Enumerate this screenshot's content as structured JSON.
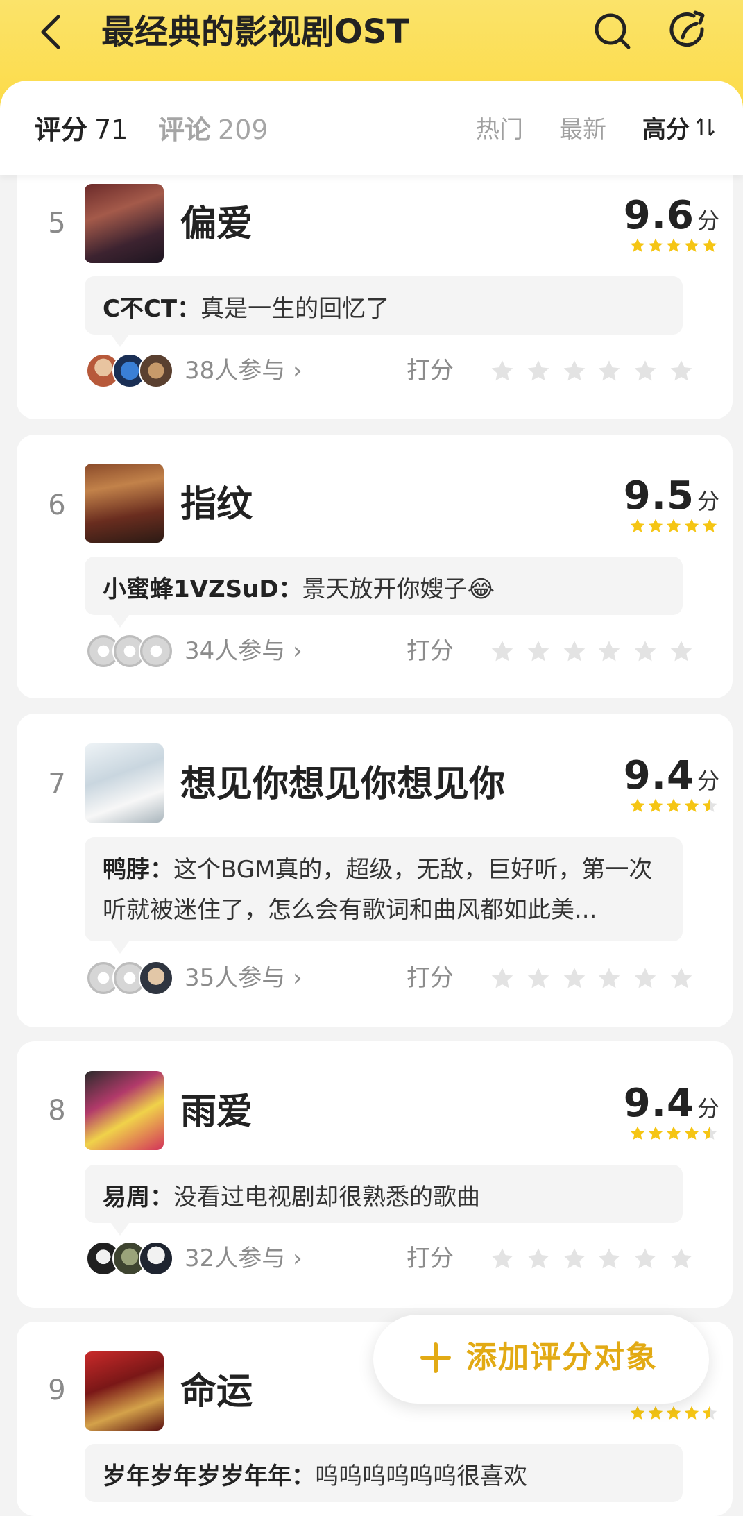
{
  "header": {
    "title": "最经典的影视剧OST",
    "back_icon": "chevron-left-icon",
    "search_icon": "search-icon",
    "share_icon": "share-icon",
    "bg_color": "#fcd93f"
  },
  "tabs": {
    "score_label": "评分",
    "score_count": "71",
    "comment_label": "评论",
    "comment_count": "209",
    "sort_hot": "热门",
    "sort_new": "最新",
    "sort_high": "高分",
    "sort_icon": "sort-toggle-icon"
  },
  "items": [
    {
      "rank": "5",
      "title": "偏爱",
      "score": "9.6",
      "score_unit": "分",
      "stars": 5,
      "comment_user": "C不CT：",
      "comment_text": "真是一生的回忆了",
      "participants": "38人参与",
      "rate_label": "打分"
    },
    {
      "rank": "6",
      "title": "指纹",
      "score": "9.5",
      "score_unit": "分",
      "stars": 5,
      "comment_user": "小蜜蜂1VZSuD：",
      "comment_text": "景天放开你嫂子😂",
      "participants": "34人参与",
      "rate_label": "打分"
    },
    {
      "rank": "7",
      "title": "想见你想见你想见你",
      "score": "9.4",
      "score_unit": "分",
      "stars": 4.5,
      "comment_user": "鸭脖：",
      "comment_text": "这个BGM真的，超级，无敌，巨好听，第一次听就被迷住了，怎么会有歌词和曲风都如此美...",
      "participants": "35人参与",
      "rate_label": "打分"
    },
    {
      "rank": "8",
      "title": "雨爱",
      "score": "9.4",
      "score_unit": "分",
      "stars": 4.5,
      "comment_user": "易周：",
      "comment_text": "没看过电视剧却很熟悉的歌曲",
      "participants": "32人参与",
      "rate_label": "打分"
    },
    {
      "rank": "9",
      "title": "命运",
      "stars": 4.5,
      "comment_user": "岁年岁年岁岁年年：",
      "comment_text": "呜呜呜呜呜呜很喜欢"
    }
  ],
  "add_button": {
    "label": "添加评分对象",
    "icon": "plus-icon",
    "color": "#e2aa14"
  },
  "colors": {
    "star_yellow": "#f5c514",
    "star_gray": "#e3e3e3"
  }
}
